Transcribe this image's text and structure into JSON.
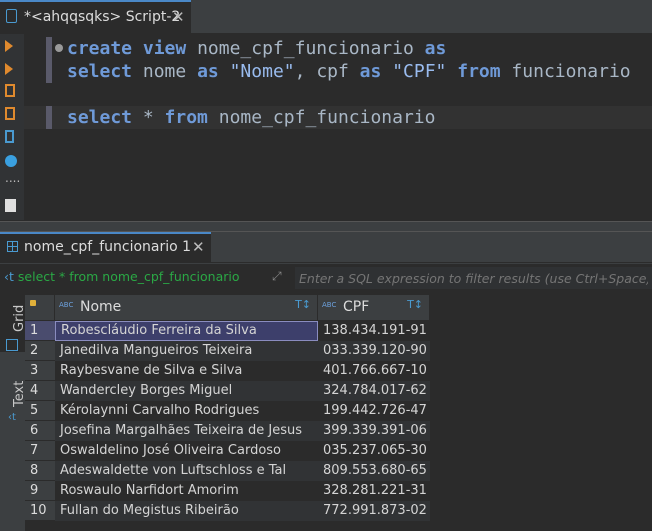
{
  "editor_tab": {
    "title": "*<ahqqsqks> Script-2",
    "close": "✕"
  },
  "code": {
    "lines": [
      [
        [
          "kw",
          "create"
        ],
        [
          "op",
          " "
        ],
        [
          "kw",
          "view"
        ],
        [
          "id",
          " nome_cpf_funcionario "
        ],
        [
          "kw",
          "as"
        ]
      ],
      [
        [
          "kw",
          "select"
        ],
        [
          "id",
          " nome "
        ],
        [
          "kw",
          "as"
        ],
        [
          "op",
          " "
        ],
        [
          "str",
          "\"Nome\""
        ],
        [
          "op",
          ", "
        ],
        [
          "id",
          "cpf "
        ],
        [
          "kw",
          "as"
        ],
        [
          "op",
          " "
        ],
        [
          "str",
          "\"CPF\""
        ],
        [
          "op",
          " "
        ],
        [
          "kw",
          "from"
        ],
        [
          "id",
          " funcionario"
        ]
      ],
      [],
      [
        [
          "kw",
          "select"
        ],
        [
          "op",
          " * "
        ],
        [
          "kw",
          "from"
        ],
        [
          "id",
          " nome_cpf_funcionario"
        ]
      ]
    ]
  },
  "gutter_icons": [
    "execute-statement-icon",
    "execute-script-icon",
    "explain-plan-icon",
    "load-plan-icon",
    "open-script-icon",
    "settings-icon",
    "more-icon",
    "export-icon"
  ],
  "result_tab": {
    "title": "nome_cpf_funcionario 1",
    "close": "✕"
  },
  "filter": {
    "query": "select * from nome_cpf_funcionario",
    "placeholder": "Enter a SQL expression to filter results (use Ctrl+Space)"
  },
  "side_tabs": {
    "grid": "Grid",
    "text": "Text"
  },
  "grid": {
    "columns": [
      {
        "type": "ABC",
        "name": "Nome"
      },
      {
        "type": "ABC",
        "name": "CPF"
      }
    ],
    "rows": [
      {
        "n": "1",
        "nome": "Robescláudio Ferreira da Silva",
        "cpf": "138.434.191-91"
      },
      {
        "n": "2",
        "nome": "Janedilva Mangueiros Teixeira",
        "cpf": "033.339.120-90"
      },
      {
        "n": "3",
        "nome": "Raybesvane de Silva e Silva",
        "cpf": "401.766.667-10"
      },
      {
        "n": "4",
        "nome": "Wandercley Borges Miguel",
        "cpf": "324.784.017-62"
      },
      {
        "n": "5",
        "nome": "Kérolaynni Carvalho Rodrigues",
        "cpf": "199.442.726-47"
      },
      {
        "n": "6",
        "nome": "Josefina Margalhães Teixeira de Jesus",
        "cpf": "399.339.391-06"
      },
      {
        "n": "7",
        "nome": "Oswaldelino José Oliveira Cardoso",
        "cpf": "035.237.065-30"
      },
      {
        "n": "8",
        "nome": "Adeswaldette von Luftschloss e Tal",
        "cpf": "809.553.680-65"
      },
      {
        "n": "9",
        "nome": "Roswaulo Narfidort Amorim",
        "cpf": "328.281.221-31"
      },
      {
        "n": "10",
        "nome": "Fullan do Megistus Ribeirão",
        "cpf": "772.991.873-02"
      }
    ],
    "selected_row": 0
  },
  "colors": {
    "accent": "#4a88c7",
    "keyword": "#6f9ad8",
    "filter_query": "#2aa845",
    "warning": "#d9534f"
  }
}
